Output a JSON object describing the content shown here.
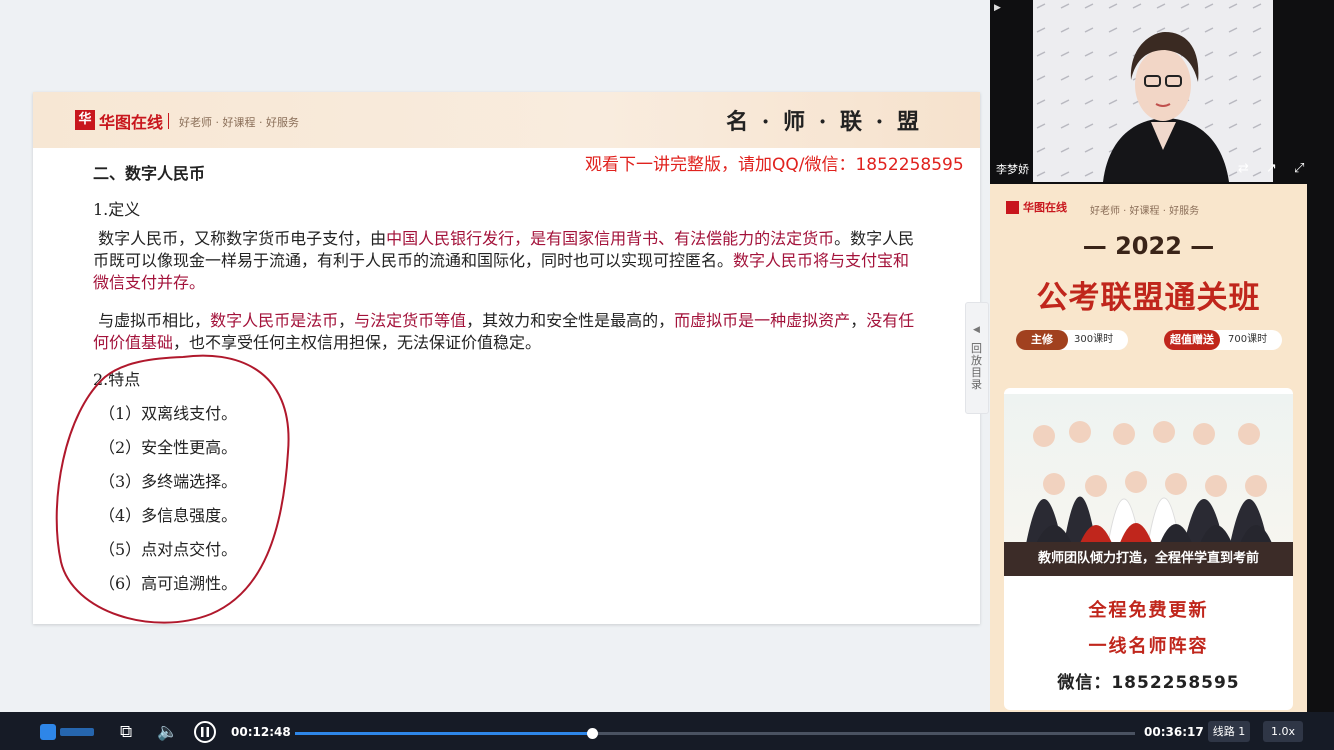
{
  "slide": {
    "brand": "华图在线",
    "slogan": "好老师 · 好课程 · 好服务",
    "header_right": "名 · 师 · 联 · 盟",
    "watermark": "观看下一讲完整版，请加QQ/微信：1852258595",
    "section_title": "二、数字人民币",
    "definition_heading": "1.定义",
    "para1": {
      "a": "数字人民币，又称数字货币电子支付，由",
      "b": "中国人民银行发行，是有国家信用背书、有法偿能力的法定货币",
      "c": "。数字人民币既可以像现金一样易于流通，有利于人民币的流通和国际化，同时也可以实现可控匿名。",
      "d": "数字人民币将与支付宝和微信支付并存。"
    },
    "para2": {
      "a": "与虚拟币相比，",
      "b": "数字人民币是法币",
      "c": "，",
      "d": "与法定货币等值",
      "e": "，其效力和安全性是最高的，",
      "f": "而虚拟币是一种虚拟资产",
      "g": "，",
      "h": "没有任何价值基础",
      "i": "，也不享受任何主权信用担保，无法保证价值稳定。"
    },
    "features_heading": "2.特点",
    "features": [
      "（1）双离线支付。",
      "（2）安全性更高。",
      "（3）多终端选择。",
      "（4）多信息强度。",
      "（5）点对点交付。",
      "（6）高可追溯性。"
    ]
  },
  "catalog_tab": {
    "label": "回放目录"
  },
  "teacher_video": {
    "name": "李梦娇"
  },
  "ad": {
    "brand": "华图在线",
    "slogan": "好老师 · 好课程 · 好服务",
    "year": "— 2022 —",
    "title": "公考联盟通关班",
    "pill1_tag": "主修",
    "pill1_value": "300课时",
    "pill2_tag": "超值赠送",
    "pill2_value": "700课时",
    "band": "教师团队倾力打造，全程伴学直到考前",
    "line1": "全程免费更新",
    "line2": "一线名师阵容",
    "wechat": "微信：1852258595"
  },
  "player": {
    "current_time": "00:12:48",
    "total_time": "00:36:17",
    "progress": 0.353,
    "line_label": "线路 1",
    "speed_label": "1.0x"
  },
  "colors": {
    "accent_red": "#c8161d",
    "text_red": "#a3123a",
    "progress_blue": "#2e86e8"
  }
}
